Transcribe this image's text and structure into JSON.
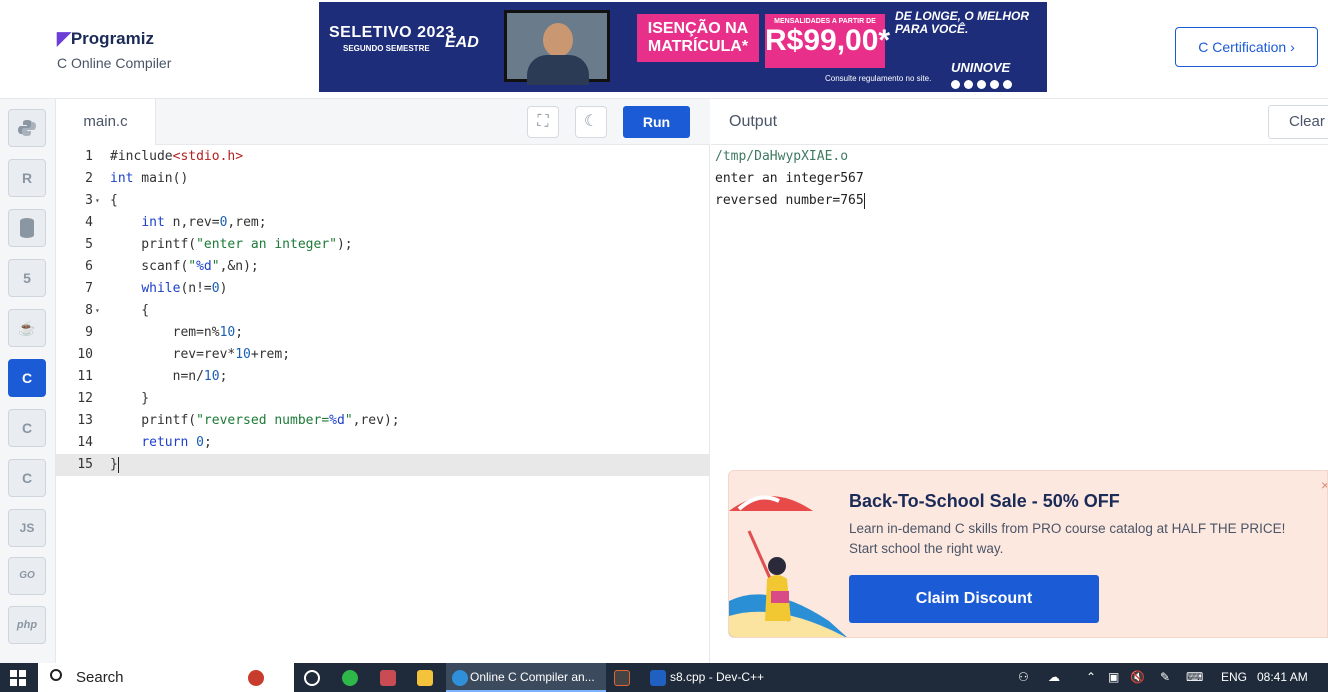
{
  "header": {
    "logo_text": "Programiz",
    "subtitle": "C Online Compiler",
    "cert_button": "C Certification ›"
  },
  "banner": {
    "title": "SELETIVO 2023",
    "subtitle": "SEGUNDO SEMESTRE",
    "ead": "EAD",
    "isencao": "ISENÇÃO NA MATRÍCULA*",
    "mensalidades": "MENSALIDADES A PARTIR DE",
    "price": "R$99,00*",
    "slogan": "DE LONGE, O MELHOR PARA VOCÊ.",
    "brand": "UNINOVE",
    "consulte": "Consulte regulamento no site."
  },
  "sidebar": {
    "items": [
      {
        "icon": "python-icon",
        "label": ""
      },
      {
        "icon": "r-icon",
        "label": "R"
      },
      {
        "icon": "sql-icon",
        "label": ""
      },
      {
        "icon": "html5-icon",
        "label": "5"
      },
      {
        "icon": "java-icon",
        "label": "☕"
      },
      {
        "icon": "c-icon",
        "label": "C",
        "active": true
      },
      {
        "icon": "cpp-icon",
        "label": "C"
      },
      {
        "icon": "csharp-icon",
        "label": "C"
      },
      {
        "icon": "js-icon",
        "label": "JS"
      },
      {
        "icon": "go-icon",
        "label": "GO"
      },
      {
        "icon": "php-icon",
        "label": "php"
      }
    ]
  },
  "editor": {
    "tab": "main.c",
    "run_label": "Run",
    "lines": [
      "1",
      "2",
      "3",
      "4",
      "5",
      "6",
      "7",
      "8",
      "9",
      "10",
      "11",
      "12",
      "13",
      "14",
      "15"
    ]
  },
  "output": {
    "title": "Output",
    "clear_label": "Clear",
    "path": "/tmp/DaHwypXIAE.o",
    "line1": "enter an integer567",
    "line2": "reversed number=765"
  },
  "ad": {
    "title": "Back-To-School Sale - 50% OFF",
    "desc1": "Learn in-demand C skills from PRO course catalog at HALF THE PRICE!",
    "desc2": "Start school the right way.",
    "button": "Claim Discount",
    "close": "×"
  },
  "taskbar": {
    "search": "Search",
    "task1": "Online C Compiler an...",
    "task2": "s8.cpp - Dev-C++",
    "lang": "ENG",
    "time": "08:41 AM"
  },
  "colors": {
    "brand_blue": "#1c5bd6",
    "banner_navy": "#1d2d79",
    "banner_pink": "#e8308a",
    "ad_bg": "#fde8df"
  }
}
